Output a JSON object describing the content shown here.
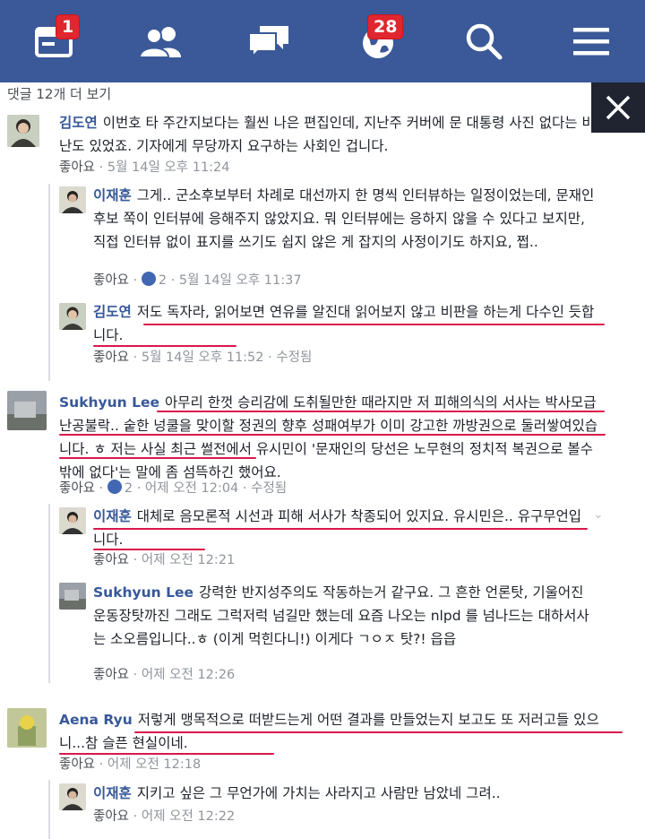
{
  "nav": {
    "news_badge": "1",
    "notif_badge": "28",
    "colors": {
      "bar": "#3b5998",
      "badge": "#e0262e"
    }
  },
  "more_comments": "댓글 12개 더 보기",
  "comments": [
    {
      "author": "김도연",
      "text": "이번호 타 주간지보다는 훨씬 나은 편집인데, 지난주 커버에 문 대통령 사진 없다는 비난도 있었죠. 기자에게 무당까지 요구하는 사회인 겁니다.",
      "like": "좋아요",
      "time": "5월 14일 오후 11:24"
    },
    {
      "author": "이재훈",
      "text": "그게.. 군소후보부터 차례로 대선까지 한 명씩 인터뷰하는 일정이었는데, 문재인 후보 쪽이 인터뷰에 응해주지 않았지요. 뭐 인터뷰에는 응하지 않을 수 있다고 보지만, 직접 인터뷰 없이 표지를 쓰기도 쉽지 않은 게 잡지의 사정이기도 하지요, 쩝..",
      "like": "좋아요",
      "likes_count": "2",
      "time": "5월 14일 오후 11:37"
    },
    {
      "author": "김도연",
      "text": "저도 독자라, 읽어보면 연유를 알진대 읽어보지 않고 비판을 하는게 다수인 듯합니다.",
      "like": "좋아요",
      "time": "5월 14일 오후 11:52",
      "edited": "수정됨"
    },
    {
      "author": "Sukhyun Lee",
      "text": "아무리 한껏 승리감에 도취될만한 때라지만 저 피해의식의 서사는 박사모급 난공불락.. 숱한 넝쿨을 맞이할 정권의 향후 성패여부가 이미 강고한 까방권으로 둘러쌓여있습니다. ㅎ 저는 사실 최근 썰전에서 유시민이 '문재인의 당선은 노무현의 정치적 복권으로 볼수밖에 없다'는 말에 좀 섬뜩하긴 했어요.",
      "like": "좋아요",
      "likes_count": "2",
      "time": "어제 오전 12:04",
      "edited": "수정됨"
    },
    {
      "author": "이재훈",
      "text": "대체로 음모론적 시선과 피해 서사가 착종되어 있지요. 유시민은.. 유구무언입니다.",
      "like": "좋아요",
      "time": "어제 오전 12:21"
    },
    {
      "author": "Sukhyun Lee",
      "text": "강력한 반지성주의도 작동하는거 같구요. 그 흔한 언론탓, 기울어진 운동장탓까진 그래도 그럭저럭 넘길만 했는데 요즘 나오는 nlpd 를 넘나드는 대하서사는 소오름입니다..ㅎ (이게 먹힌다니!) 이게다 ㄱㅇㅈ 탓?! 읍읍",
      "like": "좋아요",
      "time": "어제 오전 12:26"
    },
    {
      "author": "Aena Ryu",
      "text": "저렇게 맹목적으로 떠받드는게 어떤 결과를 만들었는지 보고도 또 저러고들 있으니...참 슬픈 현실이네.",
      "like": "좋아요",
      "time": "어제 오전 12:18"
    },
    {
      "author": "이재훈",
      "text": "지키고 싶은 그 무언가에 가치는 사라지고 사람만 남았네 그려..",
      "like": "좋아요",
      "time": "어제 오전 12:22"
    }
  ]
}
